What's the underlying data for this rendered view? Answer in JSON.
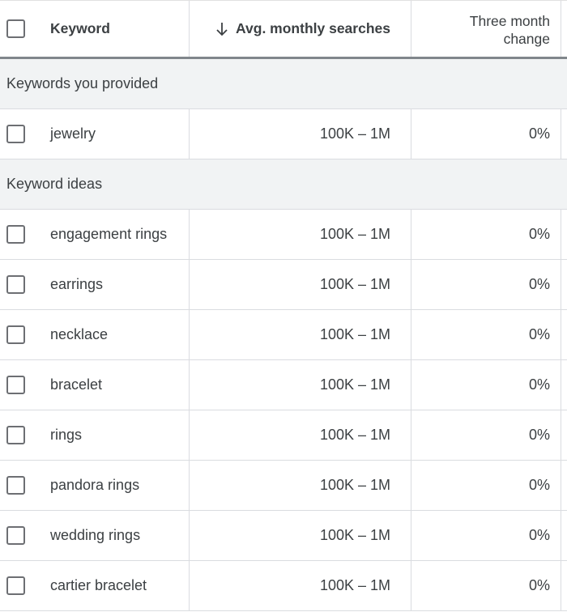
{
  "table": {
    "columns": {
      "keyword": "Keyword",
      "avg_monthly_searches": "Avg. monthly searches",
      "three_month_change_line1": "Three month",
      "three_month_change_line2": "change"
    },
    "sort": {
      "column": "avg_monthly_searches",
      "direction": "descending",
      "icon": "arrow-down-icon"
    },
    "groups": [
      {
        "label": "Keywords you provided",
        "rows": [
          {
            "keyword": "jewelry",
            "avg_monthly_searches": "100K – 1M",
            "three_month_change": "0%"
          }
        ]
      },
      {
        "label": "Keyword ideas",
        "rows": [
          {
            "keyword": "engagement rings",
            "avg_monthly_searches": "100K – 1M",
            "three_month_change": "0%"
          },
          {
            "keyword": "earrings",
            "avg_monthly_searches": "100K – 1M",
            "three_month_change": "0%"
          },
          {
            "keyword": "necklace",
            "avg_monthly_searches": "100K – 1M",
            "three_month_change": "0%"
          },
          {
            "keyword": "bracelet",
            "avg_monthly_searches": "100K – 1M",
            "three_month_change": "0%"
          },
          {
            "keyword": "rings",
            "avg_monthly_searches": "100K – 1M",
            "three_month_change": "0%"
          },
          {
            "keyword": "pandora rings",
            "avg_monthly_searches": "100K – 1M",
            "three_month_change": "0%"
          },
          {
            "keyword": "wedding rings",
            "avg_monthly_searches": "100K – 1M",
            "three_month_change": "0%"
          },
          {
            "keyword": "cartier bracelet",
            "avg_monthly_searches": "100K – 1M",
            "three_month_change": "0%"
          }
        ]
      }
    ]
  },
  "colors": {
    "text": "#3c4043",
    "group_background": "#f1f3f4",
    "border": "#dadce0",
    "header_divider": "#80868b",
    "checkbox_border": "#6d6f73"
  }
}
